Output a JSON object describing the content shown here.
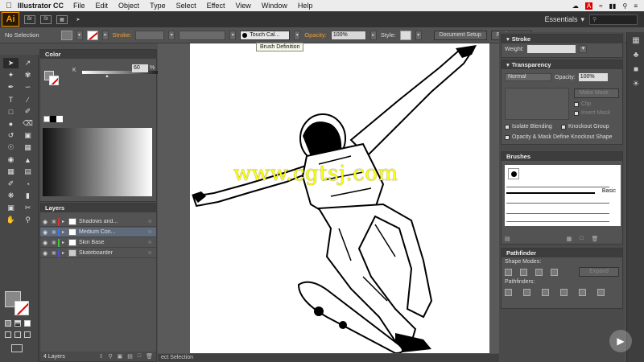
{
  "menubar": {
    "app_name": "Illustrator CC",
    "items": [
      "File",
      "Edit",
      "Object",
      "Type",
      "Select",
      "Effect",
      "View",
      "Window",
      "Help"
    ]
  },
  "appbar": {
    "logo": "Ai",
    "workspace": "Essentials",
    "btn1": "Br",
    "btn2": "St"
  },
  "control": {
    "selection": "No Selection",
    "stroke_label": "Stroke:",
    "brush": "Touch Cal...",
    "opacity_label": "Opacity:",
    "opacity_value": "100%",
    "style_label": "Style:",
    "document_setup": "Document Setup",
    "preferences": "Preferences",
    "tooltip": "Brush Definition"
  },
  "color_panel": {
    "tab": "Color",
    "k_label": "K",
    "k_value": "60",
    "pct": "%"
  },
  "layers_panel": {
    "tab": "Layers",
    "layers": [
      {
        "name": "Shadows and...",
        "color": "#e03030"
      },
      {
        "name": "Medium Con...",
        "color": "#4a6ee0"
      },
      {
        "name": "Skin Base",
        "color": "#40c040"
      },
      {
        "name": "Skateboarder",
        "color": "#4a50d0"
      }
    ],
    "footer": "4 Layers"
  },
  "status": {
    "text": "ect Selection"
  },
  "watermark": "www.cgtsj.com",
  "stroke_panel": {
    "title": "Stroke",
    "weight_label": "Weight:"
  },
  "transparency_panel": {
    "title": "Transparency",
    "mode": "Normal",
    "opacity_label": "Opacity:",
    "opacity_value": "100%",
    "make_mask": "Make Mask",
    "clip": "Clip",
    "invert_mask": "Invert Mask",
    "isolate_blending": "Isolate Blending",
    "knockout_group": "Knockout Group",
    "opacity_mask": "Opacity & Mask Define Knockout Shape"
  },
  "brushes_panel": {
    "title": "Brushes",
    "basic": "Basic"
  },
  "pathfinder_panel": {
    "title": "Pathfinder",
    "shape_modes": "Shape Modes:",
    "expand": "Expand",
    "pathfinders": "Pathfinders:"
  },
  "colors": {
    "accent": "#f79500",
    "canvas": "#ffffff",
    "ui_bg": "#535353"
  }
}
